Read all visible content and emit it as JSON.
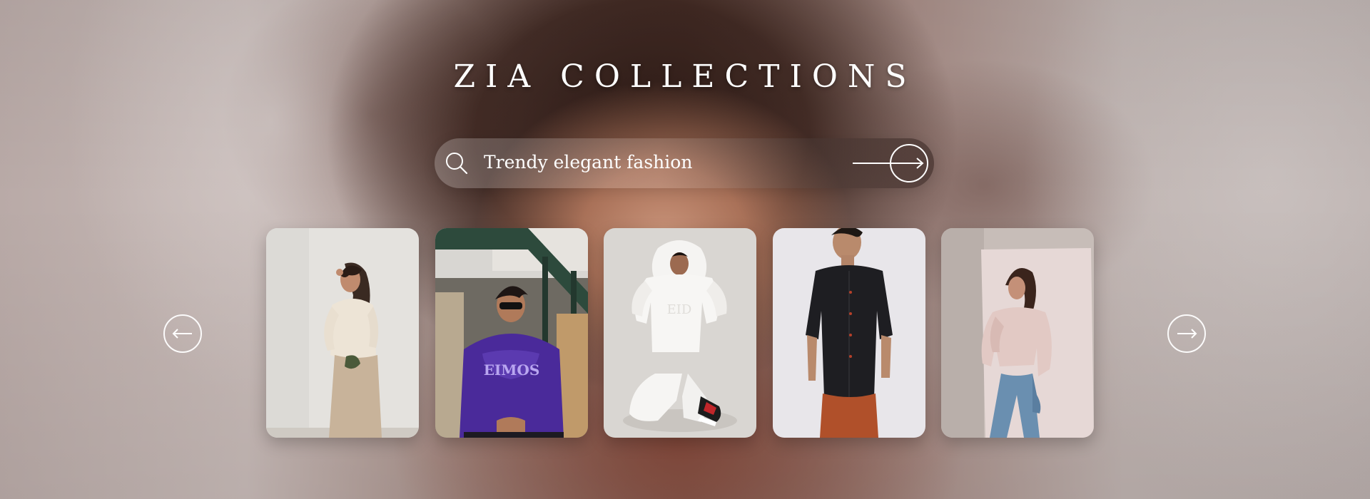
{
  "brand": {
    "title": "ZIA COLLECTIONS"
  },
  "search": {
    "query": "Trendy elegant fashion",
    "icon": "search-icon",
    "submit_icon": "arrow-right-circle-icon"
  },
  "carousel": {
    "prev_icon": "arrow-left-icon",
    "next_icon": "arrow-right-icon",
    "items": [
      {
        "subject": "woman in cream sweater and beige trousers"
      },
      {
        "subject": "man in purple hoodie and sunglasses"
      },
      {
        "subject": "woman in white hooded tracksuit kneeling"
      },
      {
        "subject": "man in black shirt and rust trousers"
      },
      {
        "subject": "woman in blush satin shirt and jeans"
      }
    ]
  },
  "colors": {
    "text": "#ffffff",
    "hoodie_purple": "#4a2a9a",
    "rust": "#b0502a"
  }
}
